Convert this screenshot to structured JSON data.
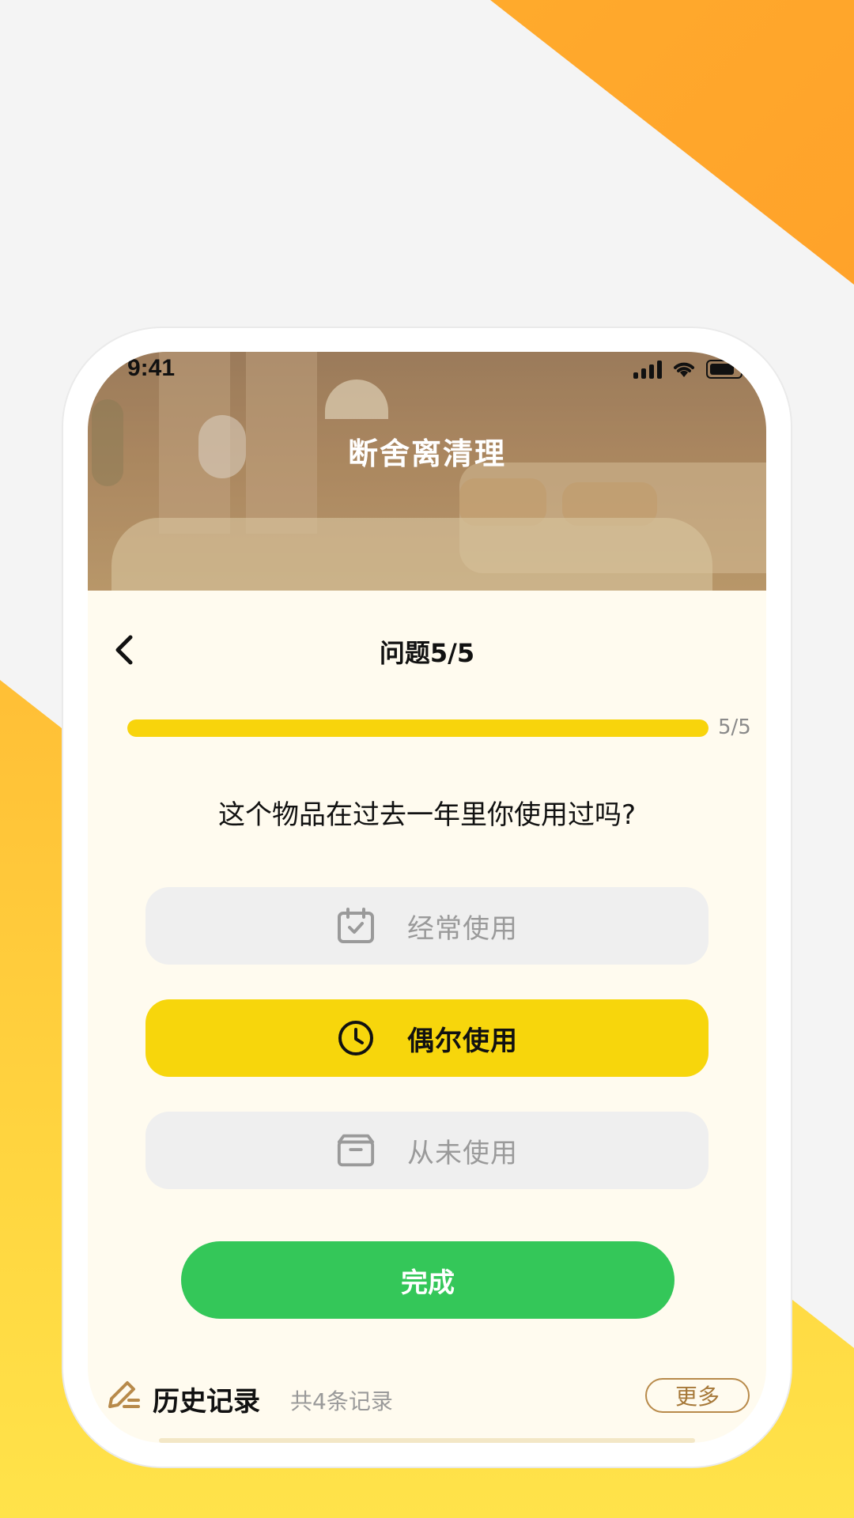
{
  "status_bar": {
    "time": "9:41"
  },
  "header": {
    "title": "断舍离清理"
  },
  "nav": {
    "title": "问题5/5"
  },
  "progress": {
    "text": "5/5",
    "fraction": 1.0
  },
  "question": {
    "text": "这个物品在过去一年里你使用过吗?"
  },
  "options": [
    {
      "label": "经常使用",
      "icon": "calendar-check-icon",
      "selected": false
    },
    {
      "label": "偶尔使用",
      "icon": "clock-icon",
      "selected": true
    },
    {
      "label": "从未使用",
      "icon": "archive-box-icon",
      "selected": false
    }
  ],
  "done_button": {
    "label": "完成"
  },
  "history": {
    "title": "历史记录",
    "count": "共4条记录",
    "more_label": "更多"
  },
  "colors": {
    "accent_yellow": "#f7d60c",
    "primary_green": "#34c759",
    "background_orange": "#ffb02e",
    "history_brown": "#b88a4a"
  }
}
